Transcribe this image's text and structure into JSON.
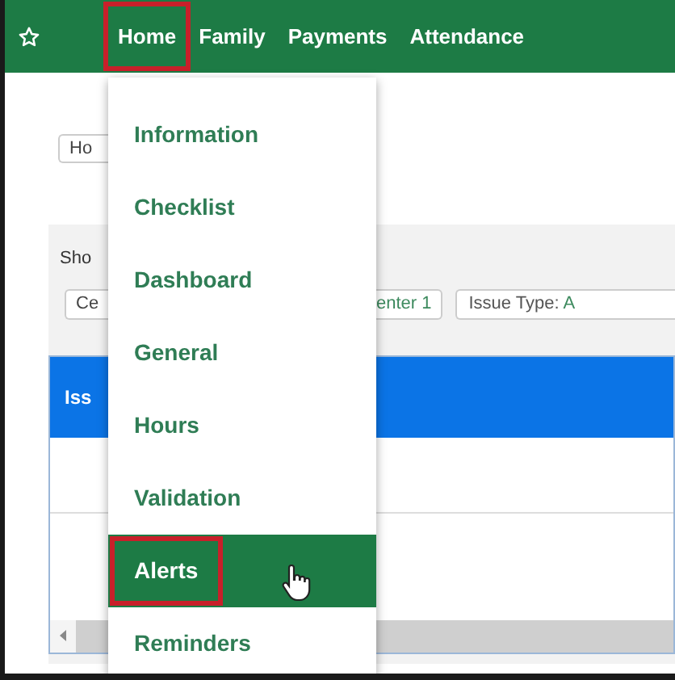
{
  "nav": {
    "items": [
      {
        "label": "Home",
        "selected": true
      },
      {
        "label": "Family",
        "selected": false
      },
      {
        "label": "Payments",
        "selected": false
      },
      {
        "label": "Attendance",
        "selected": false
      }
    ]
  },
  "page": {
    "button": "Ho",
    "section_label": "Sho",
    "chips": [
      {
        "kind": "plain",
        "text": "Ce"
      },
      {
        "kind": "value",
        "text": "enter 1"
      },
      {
        "kind": "labeled",
        "label": "Issue Type:",
        "value": "A"
      }
    ],
    "table": {
      "header": "Iss"
    }
  },
  "menu": {
    "items": [
      {
        "label": "Information",
        "selected": false,
        "hovered": false
      },
      {
        "label": "Checklist",
        "selected": false,
        "hovered": false
      },
      {
        "label": "Dashboard",
        "selected": false,
        "hovered": false
      },
      {
        "label": "General",
        "selected": false,
        "hovered": false
      },
      {
        "label": "Hours",
        "selected": false,
        "hovered": false
      },
      {
        "label": "Validation",
        "selected": false,
        "hovered": false
      },
      {
        "label": "Alerts",
        "selected": true,
        "hovered": true
      },
      {
        "label": "Reminders",
        "selected": false,
        "hovered": false
      }
    ]
  }
}
